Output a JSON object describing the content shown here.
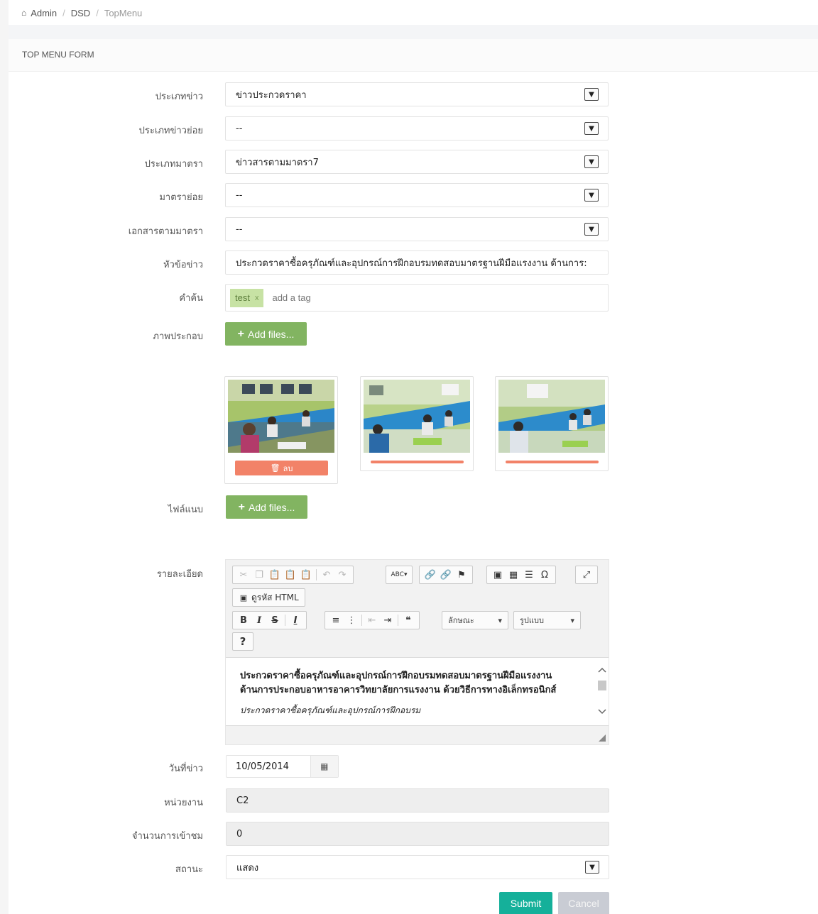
{
  "breadcrumb": {
    "home": "Admin",
    "section": "DSD",
    "current": "TopMenu"
  },
  "panel": {
    "title": "TOP MENU FORM"
  },
  "fields": {
    "news_type": {
      "label": "ประเภทข่าว",
      "value": "ข่าวประกวดราคา"
    },
    "news_subtype": {
      "label": "ประเภทข่าวย่อย",
      "value": "--"
    },
    "section_type": {
      "label": "ประเภทมาตรา",
      "value": "ข่าวสารตามมาตรา7"
    },
    "sub_section": {
      "label": "มาตราย่อย",
      "value": "--"
    },
    "section_doc": {
      "label": "เอกสารตามมาตรา",
      "value": "--"
    },
    "headline": {
      "label": "หัวข้อข่าว",
      "value": "ประกวดราคาซื้อครุภัณฑ์และอุปกรณ์การฝึกอบรมทดสอบมาตรฐานฝีมือแรงงาน ด้านการ:"
    },
    "keywords": {
      "label": "คำค้น",
      "tags": [
        "test"
      ],
      "tag_remove": "x",
      "placeholder": "add a tag"
    },
    "images": {
      "label": "ภาพประกอบ",
      "add_button": "Add files...",
      "delete_button": "ลบ"
    },
    "attachments": {
      "label": "ไฟล์แนบ",
      "add_button": "Add files..."
    },
    "details": {
      "label": "รายละเอียด",
      "source_button": "ดูรหัส HTML",
      "style_combo": "ลักษณะ",
      "format_combo": "รูปแบบ",
      "help_button": "?",
      "content_bold_line1": "ประกวดราคาซื้อครุภัณฑ์และอุปกรณ์การฝึกอบรมทดสอบมาตรฐานฝีมือแรงงาน",
      "content_bold_line2": "ด้านการประกอบอาหารอาคารวิทยาลัยการแรงงาน ด้วยวิธีการทางอิเล็กทรอนิกส์",
      "content_italic": "ประกวดราคาซื้อครุภัณฑ์และอุปกรณ์การฝึกอบรม"
    },
    "news_date": {
      "label": "วันที่ข่าว",
      "value": "10/05/2014"
    },
    "department": {
      "label": "หน่วยงาน",
      "value": "C2"
    },
    "views": {
      "label": "จำนวนการเข้าชม",
      "value": "0"
    },
    "status": {
      "label": "สถานะ",
      "value": "แสดง"
    }
  },
  "actions": {
    "submit": "Submit",
    "cancel": "Cancel"
  },
  "colors": {
    "green_button": "#82b461",
    "submit": "#15b09a",
    "cancel": "#c9ccd4",
    "delete": "#f28268",
    "tag": "#c7e2a4"
  },
  "icons": {
    "home": "home-icon",
    "select": "chevron-down-icon",
    "plus": "plus-icon",
    "trash": "trash-icon",
    "calendar": "calendar-icon"
  }
}
